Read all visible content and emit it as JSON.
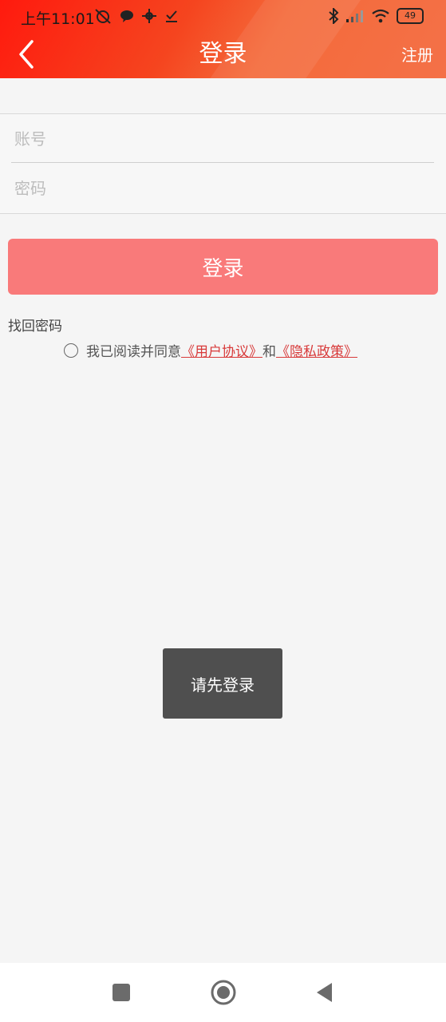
{
  "status_bar": {
    "time": "上午11:01",
    "battery": "49",
    "icons_left": [
      "alarm-off-icon",
      "chat-bubble-icon",
      "gear-icon",
      "download-done-icon"
    ],
    "icons_right": [
      "bluetooth-icon",
      "signal-icon",
      "wifi-icon",
      "battery-icon"
    ]
  },
  "header": {
    "title": "登录",
    "register_label": "注册",
    "gradient_start": "#ff1a0e",
    "gradient_end": "#f47148"
  },
  "form": {
    "account_placeholder": "账号",
    "account_value": "",
    "password_placeholder": "密码",
    "password_value": ""
  },
  "login_button": {
    "label": "登录",
    "color": "#f97a7a"
  },
  "recover_password": "找回密码",
  "agreement": {
    "prefix": "我已阅读并同意",
    "user_agreement": "《用户协议》",
    "conjunction": "和",
    "privacy_policy": "《隐私政策》",
    "link_color": "#d83a3a"
  },
  "toast": {
    "message": "请先登录"
  },
  "system_nav": {
    "buttons": [
      "recents-square-icon",
      "home-circle-icon",
      "back-triangle-icon"
    ]
  }
}
